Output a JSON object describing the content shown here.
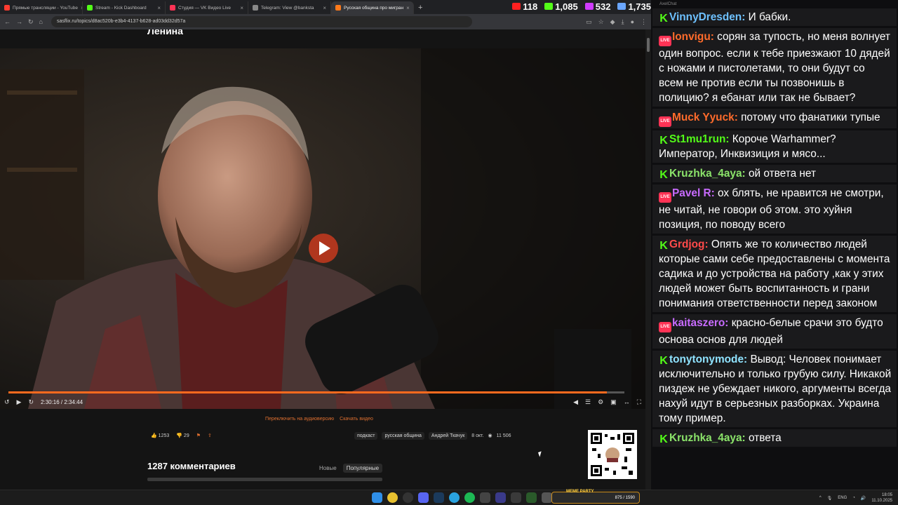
{
  "browser": {
    "tabs": [
      {
        "label": "Прямые трансляции - YouTube",
        "color": "#ff3b30",
        "active": false
      },
      {
        "label": "Stream - Kick Dashboard",
        "color": "#53fc18",
        "active": false
      },
      {
        "label": "Студия — VK Видео Live",
        "color": "#ff3355",
        "active": false
      },
      {
        "label": "Telegram: View @banksta",
        "color": "#888888",
        "active": false
      },
      {
        "label": "Русская община про мигран",
        "color": "#ff7a1a",
        "active": true
      }
    ],
    "url": "sasflix.ru/topics/d8ac520b-e3b4-4137-b628-ad03dd32d57a",
    "counters": [
      {
        "value": "118",
        "platform": "youtube",
        "color": "#ff2020"
      },
      {
        "value": "1,085",
        "platform": "kick",
        "color": "#53fc18"
      },
      {
        "value": "532",
        "platform": "vk",
        "color": "#d03bff"
      },
      {
        "value": "1,735",
        "platform": "total",
        "color": "#6aa6ff"
      }
    ]
  },
  "page": {
    "heading": "Ленина",
    "player": {
      "time": "2:30:16 / 2:34:44",
      "progress": 0.9713
    },
    "links": {
      "audio": "Переключить на аудиоверсию",
      "download": "Скачать видео"
    },
    "likes": "1253",
    "dislikes": "29",
    "tags": [
      "подкаст",
      "русская община",
      "Андрей Ткачук"
    ],
    "date": "8 окт.",
    "views": "11 506",
    "comments_count": "1287 комментариев",
    "sort": [
      "Новые",
      "Популярные"
    ]
  },
  "chat": {
    "title": "AxelChat",
    "messages": [
      {
        "platform": "kick",
        "user": "VinnyDresden",
        "user_color": "#6ec1ff",
        "text": "И бабки."
      },
      {
        "platform": "vk",
        "user": "Ionvigu",
        "user_color": "#ff6b2b",
        "text": "сорян за тупость, но меня волнует один вопрос. если к тебе приезжают 10 дядей с ножами и пистолетами, то они будут со всем не против если ты позвонишь в полицию? я ебанат или так не бывает?"
      },
      {
        "platform": "vk",
        "user": "Muck Yyuck",
        "user_color": "#ff6b2b",
        "text": "потому что фанатики тупые"
      },
      {
        "platform": "kick",
        "user": "St1mu1run",
        "user_color": "#53fc18",
        "text": "Короче Warhammer? Император, Инквизиция и мясо..."
      },
      {
        "platform": "kick",
        "user": "Kruzhka_4aya",
        "user_color": "#8be36a",
        "text": "ой ответа нет"
      },
      {
        "platform": "vk",
        "user": "Pavel R",
        "user_color": "#c86bff",
        "text": "ох блять, не нравится не смотри, не читай, не говори об этом. это хуйня позиция, по поводу всего"
      },
      {
        "platform": "kick",
        "user": "Grdjog",
        "user_color": "#ff4a4a",
        "text": "Опять же то количество людей которые сами себе предоставлены с момента садика и до устройства на работу ,как у этих людей может быть воспитанность и грани понимания ответственности перед законом"
      },
      {
        "platform": "vk",
        "user": "kaitaszero",
        "user_color": "#c86bff",
        "text": "красно-белые срачи это будто основа основ для людей"
      },
      {
        "platform": "kick",
        "user": "tonytonymode",
        "user_color": "#8fe3ff",
        "text": "Вывод: Человек понимает исключительно и только грубую силу. Никакой пиздеж не убеждает никого, аргументы всегда нахуй идут в серьезных разборках. Украина тому пример."
      },
      {
        "platform": "kick",
        "user": "Kruzhka_4aya",
        "user_color": "#8be36a",
        "text": "ответа"
      }
    ]
  },
  "taskbar": {
    "meme_label": "MEME PARTY",
    "meme_counter": "875 / 1590",
    "lang": "ENG",
    "time": "18:05",
    "date": "11.10.2025"
  }
}
